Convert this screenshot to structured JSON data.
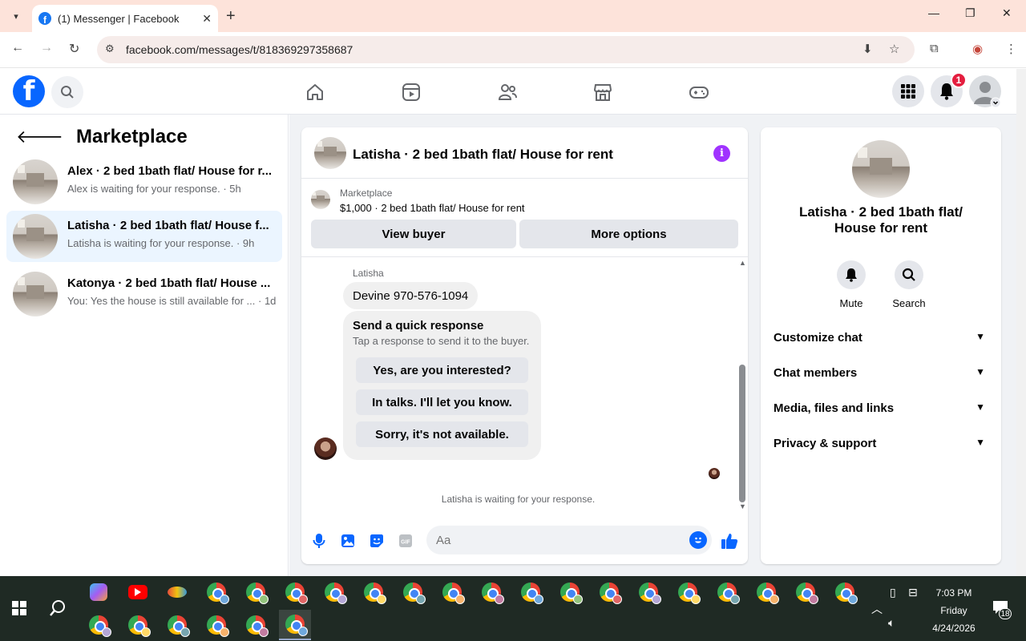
{
  "browser": {
    "tab_title": "(1) Messenger | Facebook",
    "url": "facebook.com/messages/t/818369297358687"
  },
  "fb_header": {
    "notifications_count": "1"
  },
  "left_panel": {
    "title": "Marketplace",
    "conversations": [
      {
        "name": "Alex · 2 bed 1bath flat/ House for r...",
        "sub": "Alex is waiting for your response. · 5h",
        "active": false
      },
      {
        "name": "Latisha · 2 bed 1bath flat/ House f...",
        "sub": "Latisha is waiting for your response. · 9h",
        "active": true
      },
      {
        "name": "Katonya · 2 bed 1bath flat/ House ...",
        "sub": "You: Yes the house is still available for ... · 1d",
        "active": false
      }
    ]
  },
  "chat": {
    "title": "Latisha · 2 bed 1bath flat/ House for rent",
    "marketplace_label": "Marketplace",
    "listing": "$1,000 · 2 bed 1bath flat/ House for rent",
    "view_buyer": "View buyer",
    "more_options": "More options",
    "sender": "Latisha",
    "message": "Devine 970-576-1094",
    "quick_response": {
      "heading": "Send a quick response",
      "subtext": "Tap a response to send it to the buyer.",
      "options": [
        "Yes, are you interested?",
        "In talks. I'll let you know.",
        "Sorry, it's not available."
      ]
    },
    "waiting_note": "Latisha is waiting for your response.",
    "composer_placeholder": "Aa"
  },
  "right_panel": {
    "name": "Latisha · 2 bed 1bath flat/ House for rent",
    "mute": "Mute",
    "search": "Search",
    "sections": [
      "Customize chat",
      "Chat members",
      "Media, files and links",
      "Privacy & support"
    ]
  },
  "taskbar": {
    "time": "7:03 PM",
    "day": "Friday",
    "date": "4/24/2026",
    "notification_count": "18"
  },
  "colors": {
    "fb_blue": "#0866ff",
    "messenger_purple": "#a033ff",
    "active_conv": "#ebf5ff",
    "tabbar": "#fde3da"
  }
}
